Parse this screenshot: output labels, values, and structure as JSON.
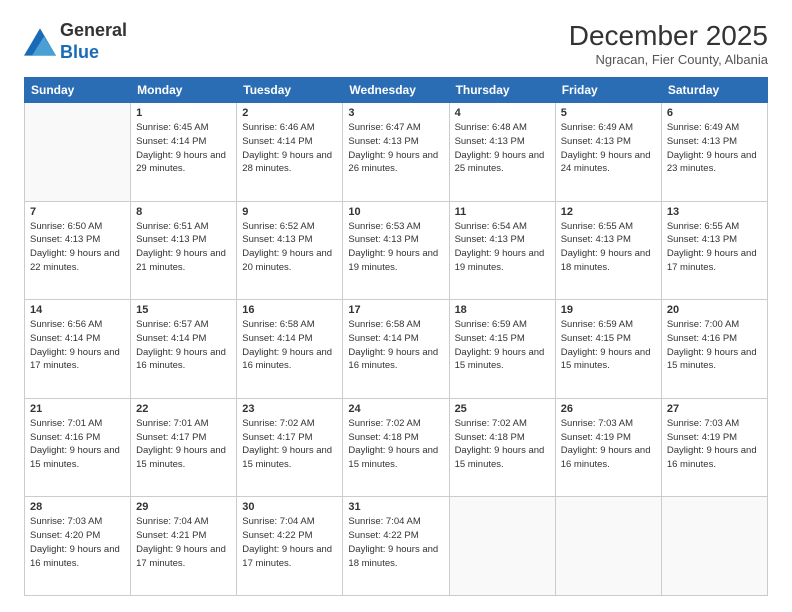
{
  "logo": {
    "general": "General",
    "blue": "Blue"
  },
  "header": {
    "month": "December 2025",
    "location": "Ngracan, Fier County, Albania"
  },
  "days_of_week": [
    "Sunday",
    "Monday",
    "Tuesday",
    "Wednesday",
    "Thursday",
    "Friday",
    "Saturday"
  ],
  "weeks": [
    [
      {
        "day": "",
        "empty": true
      },
      {
        "day": "1",
        "sunrise": "Sunrise: 6:45 AM",
        "sunset": "Sunset: 4:14 PM",
        "daylight": "Daylight: 9 hours and 29 minutes."
      },
      {
        "day": "2",
        "sunrise": "Sunrise: 6:46 AM",
        "sunset": "Sunset: 4:14 PM",
        "daylight": "Daylight: 9 hours and 28 minutes."
      },
      {
        "day": "3",
        "sunrise": "Sunrise: 6:47 AM",
        "sunset": "Sunset: 4:13 PM",
        "daylight": "Daylight: 9 hours and 26 minutes."
      },
      {
        "day": "4",
        "sunrise": "Sunrise: 6:48 AM",
        "sunset": "Sunset: 4:13 PM",
        "daylight": "Daylight: 9 hours and 25 minutes."
      },
      {
        "day": "5",
        "sunrise": "Sunrise: 6:49 AM",
        "sunset": "Sunset: 4:13 PM",
        "daylight": "Daylight: 9 hours and 24 minutes."
      },
      {
        "day": "6",
        "sunrise": "Sunrise: 6:49 AM",
        "sunset": "Sunset: 4:13 PM",
        "daylight": "Daylight: 9 hours and 23 minutes."
      }
    ],
    [
      {
        "day": "7",
        "sunrise": "Sunrise: 6:50 AM",
        "sunset": "Sunset: 4:13 PM",
        "daylight": "Daylight: 9 hours and 22 minutes."
      },
      {
        "day": "8",
        "sunrise": "Sunrise: 6:51 AM",
        "sunset": "Sunset: 4:13 PM",
        "daylight": "Daylight: 9 hours and 21 minutes."
      },
      {
        "day": "9",
        "sunrise": "Sunrise: 6:52 AM",
        "sunset": "Sunset: 4:13 PM",
        "daylight": "Daylight: 9 hours and 20 minutes."
      },
      {
        "day": "10",
        "sunrise": "Sunrise: 6:53 AM",
        "sunset": "Sunset: 4:13 PM",
        "daylight": "Daylight: 9 hours and 19 minutes."
      },
      {
        "day": "11",
        "sunrise": "Sunrise: 6:54 AM",
        "sunset": "Sunset: 4:13 PM",
        "daylight": "Daylight: 9 hours and 19 minutes."
      },
      {
        "day": "12",
        "sunrise": "Sunrise: 6:55 AM",
        "sunset": "Sunset: 4:13 PM",
        "daylight": "Daylight: 9 hours and 18 minutes."
      },
      {
        "day": "13",
        "sunrise": "Sunrise: 6:55 AM",
        "sunset": "Sunset: 4:13 PM",
        "daylight": "Daylight: 9 hours and 17 minutes."
      }
    ],
    [
      {
        "day": "14",
        "sunrise": "Sunrise: 6:56 AM",
        "sunset": "Sunset: 4:14 PM",
        "daylight": "Daylight: 9 hours and 17 minutes."
      },
      {
        "day": "15",
        "sunrise": "Sunrise: 6:57 AM",
        "sunset": "Sunset: 4:14 PM",
        "daylight": "Daylight: 9 hours and 16 minutes."
      },
      {
        "day": "16",
        "sunrise": "Sunrise: 6:58 AM",
        "sunset": "Sunset: 4:14 PM",
        "daylight": "Daylight: 9 hours and 16 minutes."
      },
      {
        "day": "17",
        "sunrise": "Sunrise: 6:58 AM",
        "sunset": "Sunset: 4:14 PM",
        "daylight": "Daylight: 9 hours and 16 minutes."
      },
      {
        "day": "18",
        "sunrise": "Sunrise: 6:59 AM",
        "sunset": "Sunset: 4:15 PM",
        "daylight": "Daylight: 9 hours and 15 minutes."
      },
      {
        "day": "19",
        "sunrise": "Sunrise: 6:59 AM",
        "sunset": "Sunset: 4:15 PM",
        "daylight": "Daylight: 9 hours and 15 minutes."
      },
      {
        "day": "20",
        "sunrise": "Sunrise: 7:00 AM",
        "sunset": "Sunset: 4:16 PM",
        "daylight": "Daylight: 9 hours and 15 minutes."
      }
    ],
    [
      {
        "day": "21",
        "sunrise": "Sunrise: 7:01 AM",
        "sunset": "Sunset: 4:16 PM",
        "daylight": "Daylight: 9 hours and 15 minutes."
      },
      {
        "day": "22",
        "sunrise": "Sunrise: 7:01 AM",
        "sunset": "Sunset: 4:17 PM",
        "daylight": "Daylight: 9 hours and 15 minutes."
      },
      {
        "day": "23",
        "sunrise": "Sunrise: 7:02 AM",
        "sunset": "Sunset: 4:17 PM",
        "daylight": "Daylight: 9 hours and 15 minutes."
      },
      {
        "day": "24",
        "sunrise": "Sunrise: 7:02 AM",
        "sunset": "Sunset: 4:18 PM",
        "daylight": "Daylight: 9 hours and 15 minutes."
      },
      {
        "day": "25",
        "sunrise": "Sunrise: 7:02 AM",
        "sunset": "Sunset: 4:18 PM",
        "daylight": "Daylight: 9 hours and 15 minutes."
      },
      {
        "day": "26",
        "sunrise": "Sunrise: 7:03 AM",
        "sunset": "Sunset: 4:19 PM",
        "daylight": "Daylight: 9 hours and 16 minutes."
      },
      {
        "day": "27",
        "sunrise": "Sunrise: 7:03 AM",
        "sunset": "Sunset: 4:19 PM",
        "daylight": "Daylight: 9 hours and 16 minutes."
      }
    ],
    [
      {
        "day": "28",
        "sunrise": "Sunrise: 7:03 AM",
        "sunset": "Sunset: 4:20 PM",
        "daylight": "Daylight: 9 hours and 16 minutes."
      },
      {
        "day": "29",
        "sunrise": "Sunrise: 7:04 AM",
        "sunset": "Sunset: 4:21 PM",
        "daylight": "Daylight: 9 hours and 17 minutes."
      },
      {
        "day": "30",
        "sunrise": "Sunrise: 7:04 AM",
        "sunset": "Sunset: 4:22 PM",
        "daylight": "Daylight: 9 hours and 17 minutes."
      },
      {
        "day": "31",
        "sunrise": "Sunrise: 7:04 AM",
        "sunset": "Sunset: 4:22 PM",
        "daylight": "Daylight: 9 hours and 18 minutes."
      },
      {
        "day": "",
        "empty": true
      },
      {
        "day": "",
        "empty": true
      },
      {
        "day": "",
        "empty": true
      }
    ]
  ]
}
